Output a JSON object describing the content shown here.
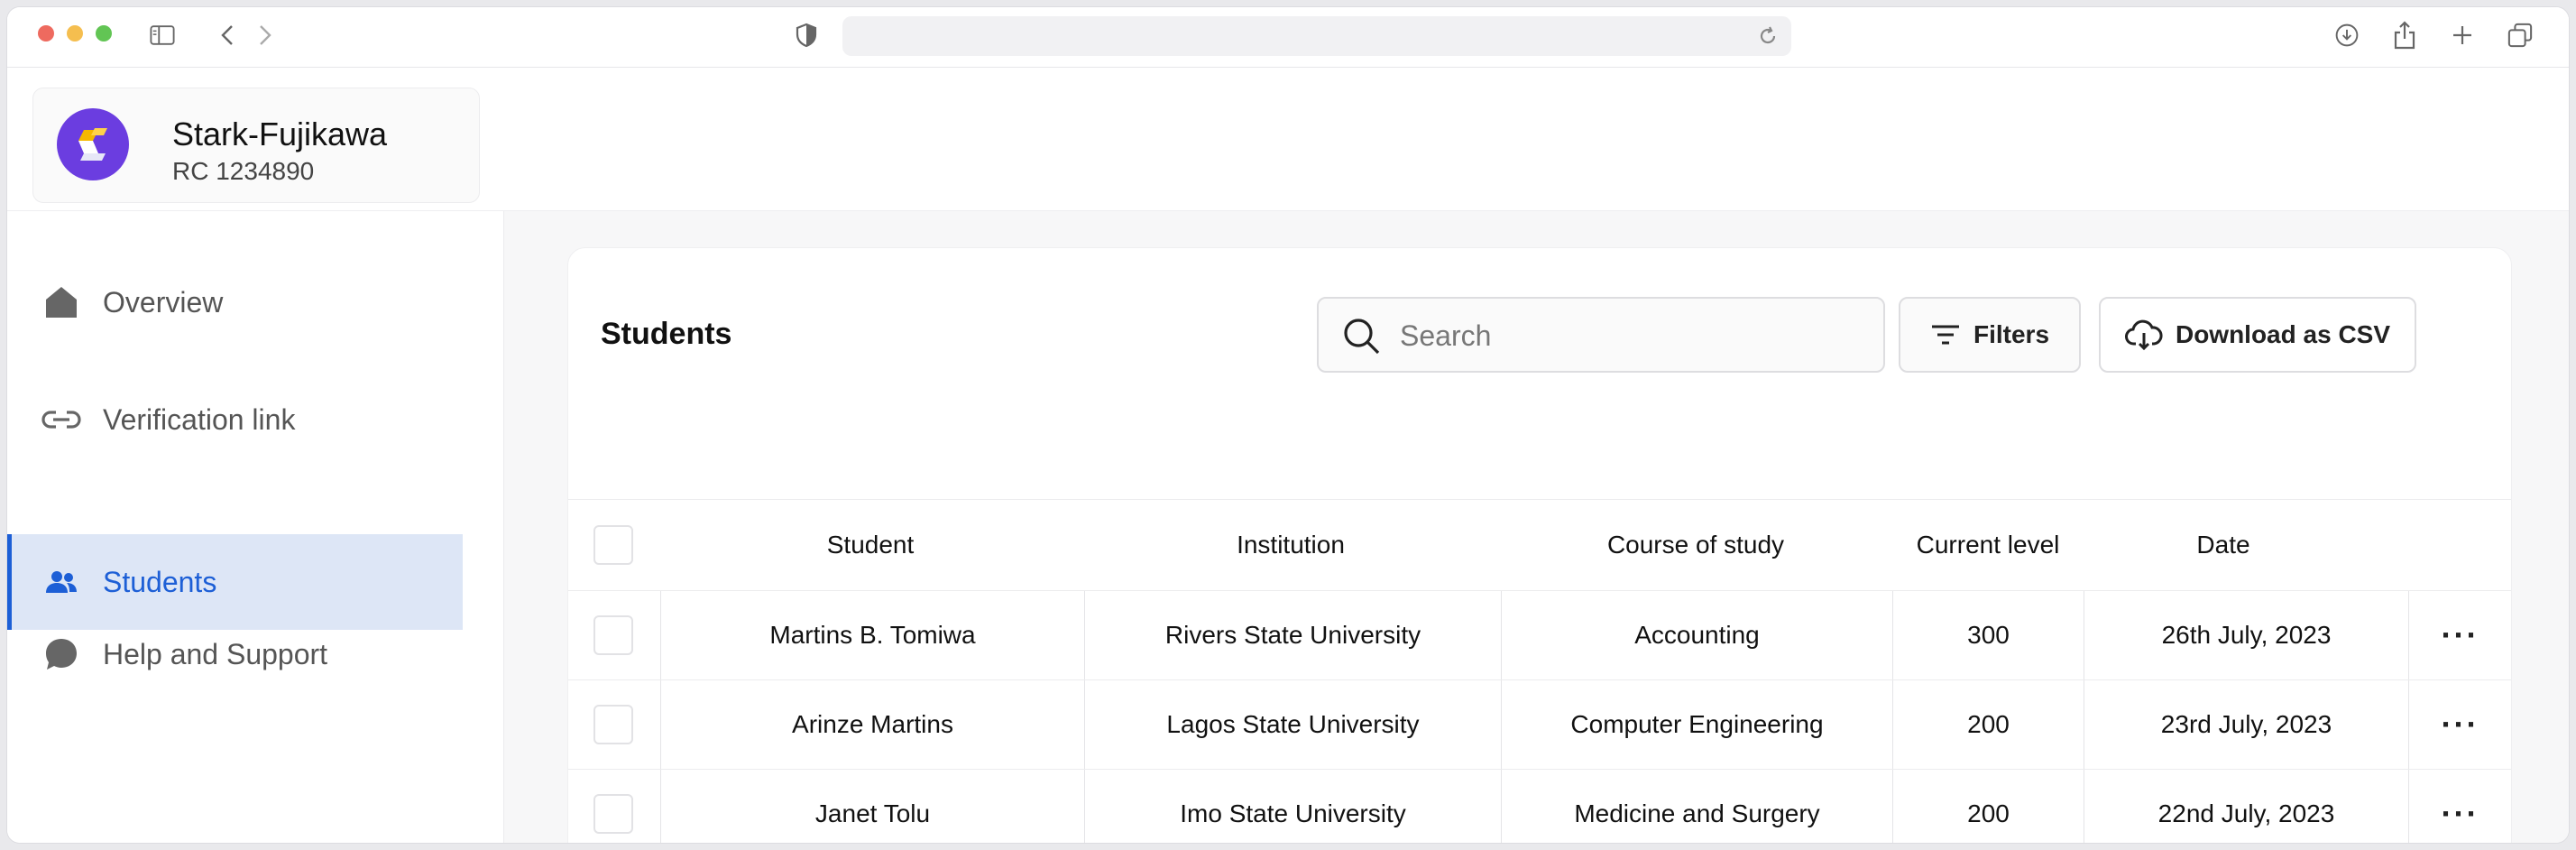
{
  "browser": {
    "icons": [
      "sidebar-toggle-icon",
      "back-chevron-icon",
      "forward-chevron-icon",
      "shield-icon",
      "reload-icon",
      "download-icon",
      "share-icon",
      "new-tab-plus-icon",
      "tabs-overview-icon"
    ]
  },
  "org": {
    "name": "Stark-Fujikawa",
    "rc": "RC 1234890",
    "logo_color": "#6b3de0"
  },
  "sidebar": {
    "items": [
      {
        "label": "Overview",
        "icon": "home-icon"
      },
      {
        "label": "Verification link",
        "icon": "link-icon"
      },
      {
        "label": "Students",
        "icon": "users-icon",
        "active": true
      },
      {
        "label": "Help and Support",
        "icon": "chat-bubble-icon"
      }
    ],
    "active_color": "#1d5fd6",
    "active_bg": "#dde6f6"
  },
  "main": {
    "title": "Students",
    "search": {
      "placeholder": "Search",
      "value": ""
    },
    "filters_label": "Filters",
    "csv_label": "Download as CSV"
  },
  "table": {
    "columns": [
      "Student",
      "Institution",
      "Course of study",
      "Current level",
      "Date"
    ],
    "rows": [
      {
        "student": "Martins B. Tomiwa",
        "institution": "Rivers State University",
        "course": "Accounting",
        "level": "300",
        "date": "26th July, 2023"
      },
      {
        "student": "Arinze Martins",
        "institution": "Lagos State University",
        "course": "Computer Engineering",
        "level": "200",
        "date": "23rd July, 2023"
      },
      {
        "student": "Janet Tolu",
        "institution": "Imo State University",
        "course": "Medicine and Surgery",
        "level": "200",
        "date": "22nd July, 2023"
      }
    ],
    "row_action": "···"
  }
}
